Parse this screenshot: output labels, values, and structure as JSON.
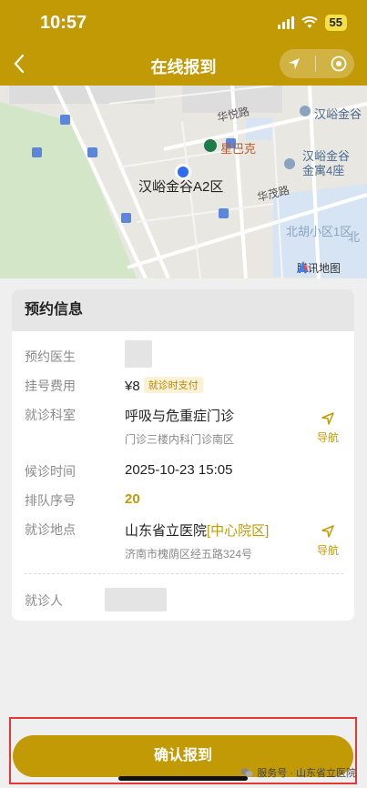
{
  "status": {
    "time": "10:57",
    "battery": "55"
  },
  "nav": {
    "back": "<",
    "title": "在线报到"
  },
  "map": {
    "pin_label": "汉峪金谷A2区",
    "poi_starbucks": "星巴克",
    "poi_hy1": "汉峪金谷",
    "poi_hy2_line1": "汉峪金谷",
    "poi_hy2_line2": "金寓4座",
    "poi_beihu": "北胡小区1区",
    "poi_bei": "北",
    "road_huayue": "华悦路",
    "road_huamao": "华茂路",
    "brand": "腾讯地图"
  },
  "card": {
    "title": "预约信息",
    "doctor_label": "预约医生",
    "fee_label": "挂号费用",
    "fee_value": "¥8",
    "fee_tag": "就诊时支付",
    "dept_label": "就诊科室",
    "dept_value": "呼吸与危重症门诊",
    "dept_sub": "门诊三楼内科门诊南区",
    "wait_label": "候诊时间",
    "wait_value": "2025-10-23 15:05",
    "queue_label": "排队序号",
    "queue_value": "20",
    "place_label": "就诊地点",
    "place_value": "山东省立医院",
    "place_tag": "[中心院区]",
    "place_sub": "济南市槐荫区经五路324号",
    "patient_label": "就诊人",
    "nav_label": "导航"
  },
  "confirm_label": "确认报到",
  "watermark": "服务号 · 山东省立医院",
  "colors": {
    "primary": "#c29a06",
    "highlight_border": "#e53935"
  }
}
